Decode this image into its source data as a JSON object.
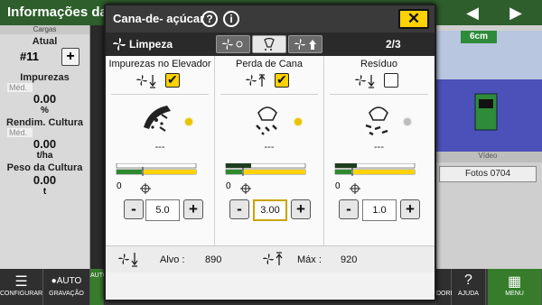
{
  "background": {
    "title": "Informações da",
    "left_panel": {
      "section_cargas": "Cargas",
      "atual_label": "Atual",
      "load_number": "#11",
      "impurezas_label": "Impurezas",
      "med1": "Méd.",
      "impurezas_value": "0.00",
      "impurezas_unit": "%",
      "rend_label": "Rendim. Cultura",
      "med2": "Méd.",
      "rend_value": "0.00",
      "rend_unit": "t/ha",
      "peso_label": "Peso da Cultura",
      "peso_value": "0.00",
      "peso_unit": "t"
    },
    "right_panel": {
      "depth": "6cm",
      "video_label": "Vídeo",
      "fotos": "Fotos 0704"
    },
    "bottom": {
      "configurar": "CONFIGURAR",
      "auto": "AUTO",
      "gravacao": "GRAVAÇÃO",
      "auto2": "AUTO",
      "dores": "DORES",
      "ajuda": "AJUDA",
      "menu": "MENU"
    }
  },
  "modal": {
    "title": "Cana-de- açúcar",
    "help_icon": "?",
    "info_icon": "i",
    "close_label": "✕",
    "mode_label": "Limpeza",
    "page": "2/3",
    "columns": [
      {
        "header": "Impurezas no Elevador",
        "checked": true,
        "dashes": "---",
        "value": "5.0",
        "zero": "0",
        "indicator": "#e8c400"
      },
      {
        "header": "Perda de Cana",
        "checked": true,
        "dashes": "---",
        "value": "3.00",
        "zero": "0",
        "indicator": "#e8c400"
      },
      {
        "header": "Resíduo",
        "checked": false,
        "dashes": "---",
        "value": "1.0",
        "zero": "0",
        "indicator": "#bdbdbd"
      }
    ],
    "footer": {
      "alvo_label": "Alvo :",
      "alvo_value": "890",
      "max_label": "Máx :",
      "max_value": "920"
    }
  },
  "colors": {
    "accent_yellow": "#ffd200",
    "jd_green": "#367c2b",
    "bar_green": "#2f8a2f",
    "bar_dark": "#1f3d1f"
  }
}
